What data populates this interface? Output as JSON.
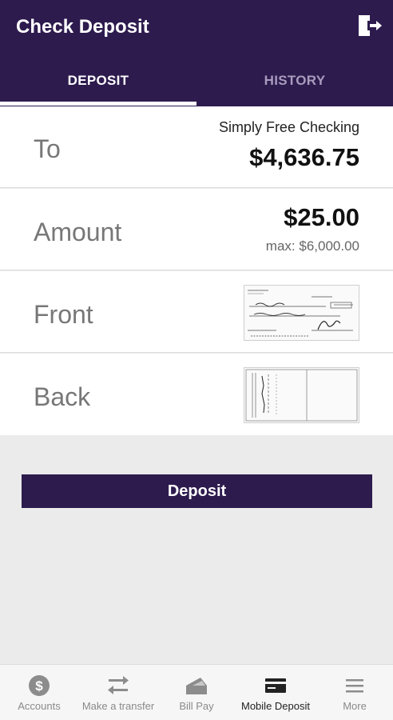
{
  "header": {
    "title": "Check Deposit",
    "logout_icon": "logout-icon"
  },
  "tabs": [
    {
      "label": "DEPOSIT",
      "active": true
    },
    {
      "label": "HISTORY",
      "active": false
    }
  ],
  "form": {
    "to": {
      "label": "To",
      "account_name": "Simply Free Checking",
      "balance": "$4,636.75"
    },
    "amount": {
      "label": "Amount",
      "value": "$25.00",
      "max": "max: $6,000.00"
    },
    "front": {
      "label": "Front"
    },
    "back": {
      "label": "Back"
    }
  },
  "deposit_button": "Deposit",
  "bottom_nav": [
    {
      "label": "Accounts",
      "icon": "dollar-circle-icon",
      "active": false
    },
    {
      "label": "Make a transfer",
      "icon": "transfer-arrows-icon",
      "active": false
    },
    {
      "label": "Bill Pay",
      "icon": "bill-pay-icon",
      "active": false
    },
    {
      "label": "Mobile Deposit",
      "icon": "mobile-deposit-icon",
      "active": true
    },
    {
      "label": "More",
      "icon": "menu-icon",
      "active": false
    }
  ],
  "colors": {
    "brand": "#2d1b4e",
    "background": "#ebebeb"
  }
}
